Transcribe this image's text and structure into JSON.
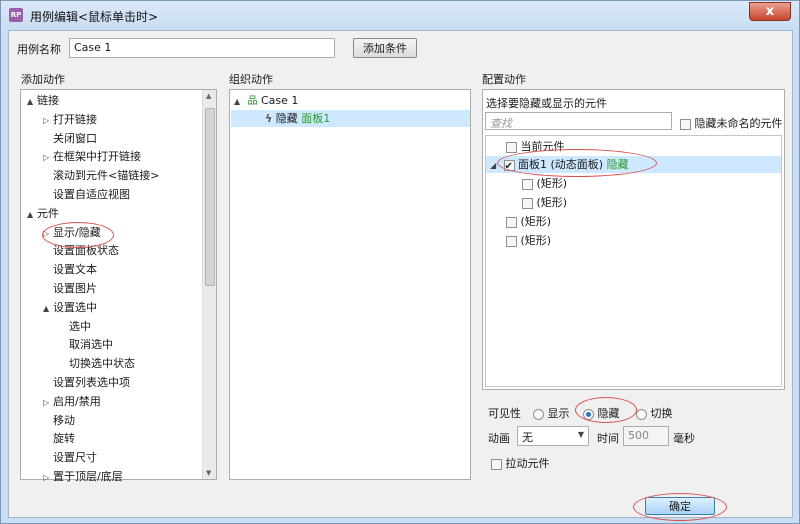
{
  "window": {
    "app_icon": "RP",
    "title": "用例编辑<鼠标单击时>",
    "close": "x"
  },
  "case_name": {
    "label": "用例名称",
    "value": "Case 1",
    "add_condition": "添加条件"
  },
  "add_actions": {
    "header": "添加动作",
    "items": [
      {
        "label": "链接",
        "expander": "▲"
      },
      {
        "label": "打开链接",
        "expander": "▷"
      },
      {
        "label": "关闭窗口",
        "expander": ""
      },
      {
        "label": "在框架中打开链接",
        "expander": "▷"
      },
      {
        "label": "滚动到元件<锚链接>",
        "expander": ""
      },
      {
        "label": "设置自适应视图",
        "expander": ""
      },
      {
        "label": "元件",
        "expander": "▲"
      },
      {
        "label": "显示/隐藏",
        "expander": "▷"
      },
      {
        "label": "设置面板状态",
        "expander": ""
      },
      {
        "label": "设置文本",
        "expander": ""
      },
      {
        "label": "设置图片",
        "expander": ""
      },
      {
        "label": "设置选中",
        "expander": "▲"
      },
      {
        "label": "选中",
        "expander": ""
      },
      {
        "label": "取消选中",
        "expander": ""
      },
      {
        "label": "切换选中状态",
        "expander": ""
      },
      {
        "label": "设置列表选中项",
        "expander": ""
      },
      {
        "label": "启用/禁用",
        "expander": "▷"
      },
      {
        "label": "移动",
        "expander": ""
      },
      {
        "label": "旋转",
        "expander": ""
      },
      {
        "label": "设置尺寸",
        "expander": ""
      },
      {
        "label": "置于顶层/底层",
        "expander": "▷"
      }
    ]
  },
  "organize": {
    "header": "组织动作",
    "case_label": "Case 1",
    "case_expander": "▲",
    "action_verb": "隐藏",
    "action_target": "面板1"
  },
  "configure": {
    "header": "配置动作",
    "subheader": "选择要隐藏或显示的元件",
    "search_placeholder": "查找",
    "hide_unnamed": "隐藏未命名的元件",
    "rows": {
      "current": "当前元件",
      "panel_label": "面板1 (动态面板)",
      "panel_status": "隐藏",
      "rect": "(矩形)"
    },
    "visibility_label": "可见性",
    "show": "显示",
    "hide": "隐藏",
    "toggle": "切换",
    "animation_label": "动画",
    "animation_value": "无",
    "time_label": "时间",
    "time_value": "500",
    "ms": "毫秒",
    "drag": "拉动元件"
  },
  "ok": "确定",
  "colors": {
    "accent": "#2b6fc2",
    "status": "#2a9a2a",
    "annotation": "#d9534f"
  }
}
